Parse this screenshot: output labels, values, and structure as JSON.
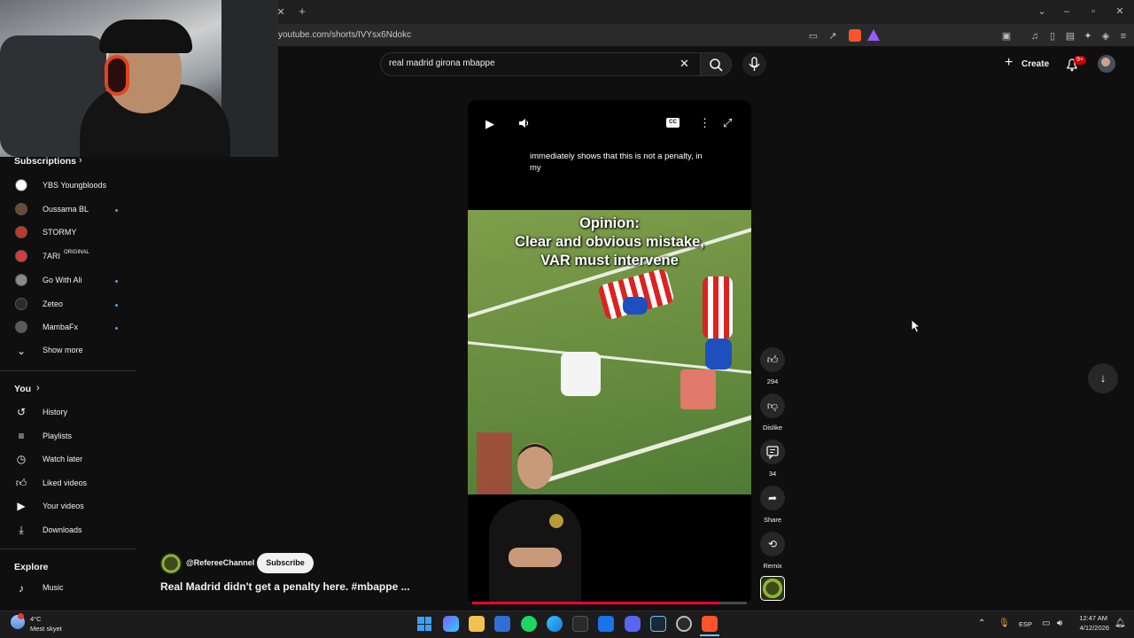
{
  "browser": {
    "url": "youtube.com/shorts/IVYsx6Ndokc",
    "new_tab": "+"
  },
  "search": {
    "query": "real madrid girona mbappe"
  },
  "header": {
    "create_label": "Create",
    "notifications_badge": "9+"
  },
  "sidebar": {
    "subscriptions_heading": "Subscriptions",
    "subscriptions": [
      {
        "label": "YBS Youngbloods",
        "new": false,
        "color": "#ffffff"
      },
      {
        "label": "Oussama BL",
        "new": true,
        "color": "#6b4a3a"
      },
      {
        "label": "STORMY",
        "new": false,
        "color": "#c0392b"
      },
      {
        "label": "7ARI",
        "suffix": "ORIGINAL",
        "new": false,
        "color": "#d43c3c"
      },
      {
        "label": "Go With Ali",
        "new": true,
        "color": "#8a8a8a"
      },
      {
        "label": "Zeteo",
        "new": true,
        "color": "#2b2b2b"
      },
      {
        "label": "MambaFx",
        "new": true,
        "color": "#5a5a5a"
      }
    ],
    "show_more": "Show more",
    "you_heading": "You",
    "you_items": [
      {
        "label": "History",
        "icon": "history-icon"
      },
      {
        "label": "Playlists",
        "icon": "playlists-icon"
      },
      {
        "label": "Watch later",
        "icon": "watch-later-icon"
      },
      {
        "label": "Liked videos",
        "icon": "liked-icon"
      },
      {
        "label": "Your videos",
        "icon": "your-videos-icon"
      },
      {
        "label": "Downloads",
        "icon": "downloads-icon"
      }
    ],
    "explore_heading": "Explore",
    "explore_items": [
      {
        "label": "Music",
        "icon": "music-icon"
      }
    ]
  },
  "video": {
    "caption": "immediately shows that this is not a penalty, in my",
    "overlay_lines": [
      "Opinion:",
      "Clear and obvious mistake,",
      "VAR must intervene"
    ],
    "progress": 0.9,
    "cc_label": "CC"
  },
  "actions": {
    "like_count": "294",
    "dislike_label": "Dislike",
    "comment_count": "34",
    "share_label": "Share",
    "remix_label": "Remix"
  },
  "channel": {
    "handle": "@RefereeChannel",
    "subscribe_label": "Subscribe",
    "title": "Real Madrid didn't get a penalty here. #mbappe ..."
  },
  "taskbar": {
    "weather_temp": "4°C",
    "weather_desc": "Mest skyet",
    "lang": "ESP",
    "time": "12:47 AM",
    "date": "4/12/2026"
  },
  "colors": {
    "accent_red": "#ff0033",
    "background": "#0f0f0f",
    "subscribe_bg": "#f1f1f1"
  }
}
